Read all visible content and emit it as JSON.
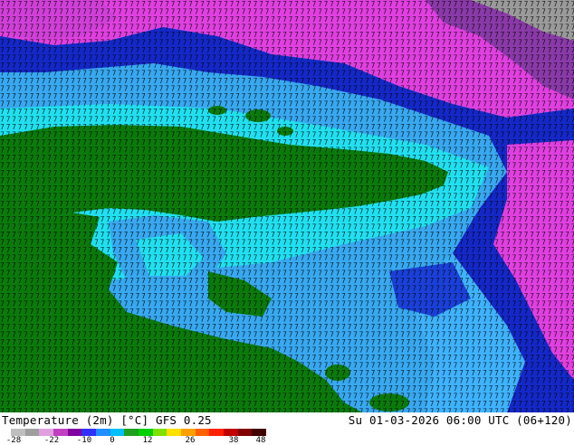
{
  "map": {
    "title": "Temperature (2m) [°C] GFS 0.25",
    "valid_time": "Su 01-03-2026 06:00 UTC (06+120)",
    "digit_field": "7",
    "colors": {
      "land_green": "#0a7a0a",
      "dark_blue": "#1428c8",
      "light_blue": "#38a8f0",
      "cyan": "#20e0f0",
      "magenta": "#e040e0",
      "purple": "#8a3aa8",
      "gray": "#9a9a9a"
    }
  },
  "legend": {
    "ticks": [
      "-28",
      "-22",
      "-10",
      "0",
      "12",
      "26",
      "38",
      "48"
    ],
    "colors": [
      "#bfbfbf",
      "#9f9f9f",
      "#e0a0e0",
      "#c040c0",
      "#8000a0",
      "#3030ff",
      "#2090ff",
      "#00c0ff",
      "#20a020",
      "#00d000",
      "#80e000",
      "#ffe000",
      "#ffa000",
      "#ff6000",
      "#ff2000",
      "#c00000",
      "#800000",
      "#400000"
    ]
  }
}
